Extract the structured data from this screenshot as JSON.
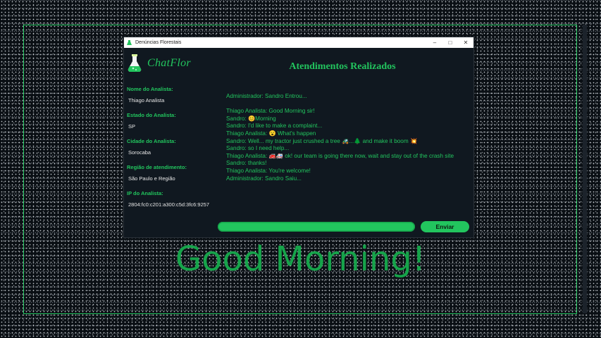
{
  "window": {
    "title": "Denúncias Florestais",
    "minimize": "–",
    "maximize": "□",
    "close": "✕"
  },
  "brand": {
    "name": "ChatFlor",
    "icon": "flask-icon"
  },
  "heading": "Atendimentos Realizados",
  "analyst": {
    "fields": [
      {
        "label": "Nome do Analista:",
        "value": "Thiago Analista"
      },
      {
        "label": "Estado do Analista:",
        "value": "SP"
      },
      {
        "label": "Cidade do Analista:",
        "value": "Sorocaba"
      },
      {
        "label": "Região de atendimento:",
        "value": "São Paulo e Região"
      },
      {
        "label": "IP do Analista:",
        "value": "2804:fc0:c201:a300:c5d:3fc6:9257"
      }
    ]
  },
  "chat": {
    "lines": [
      "Administrador: Sandro Entrou...",
      "",
      "Thiago Analista: Good Morning sir!",
      "Sandro: 😊Morning",
      "Sandro: I'd like to make a complaint...",
      "Thiago Analista: 😮 What's happen",
      "Sandro: Well... my tractor just crushed a tree 🚜...🌲 and make it boom 💥",
      "Sandro: so I need help...",
      "Thiago Analista: 🚒🚑 ok! our team is going there now, wait and stay out of the crash site",
      "Sandro: thanks!",
      "Thiago Analista: You're welcome!",
      "Administrador: Sandro Saiu..."
    ],
    "input_value": "",
    "send_label": "Enviar"
  },
  "caption": "Good Morning!",
  "colors": {
    "accent": "#22c55e",
    "background": "#101820"
  }
}
